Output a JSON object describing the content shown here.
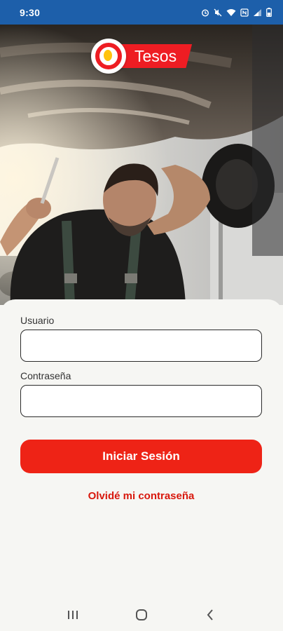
{
  "status_bar": {
    "time": "9:30",
    "icons": [
      "alarm-icon",
      "mute-icon",
      "wifi-icon",
      "nfc-icon",
      "signal-icon",
      "battery-icon"
    ]
  },
  "brand": {
    "name": "Tesos",
    "primary_color": "#ee1d23",
    "accent_color": "#ffc20e",
    "status_bar_color": "#1d5faa"
  },
  "hero": {
    "image": "mechanic-under-car-photo"
  },
  "form": {
    "username_label": "Usuario",
    "username_value": "",
    "password_label": "Contraseña",
    "password_value": "",
    "submit_label": "Iniciar Sesión",
    "forgot_label": "Olvidé mi contraseña"
  },
  "nav": {
    "buttons": [
      "recents-icon",
      "home-icon",
      "back-icon"
    ]
  }
}
